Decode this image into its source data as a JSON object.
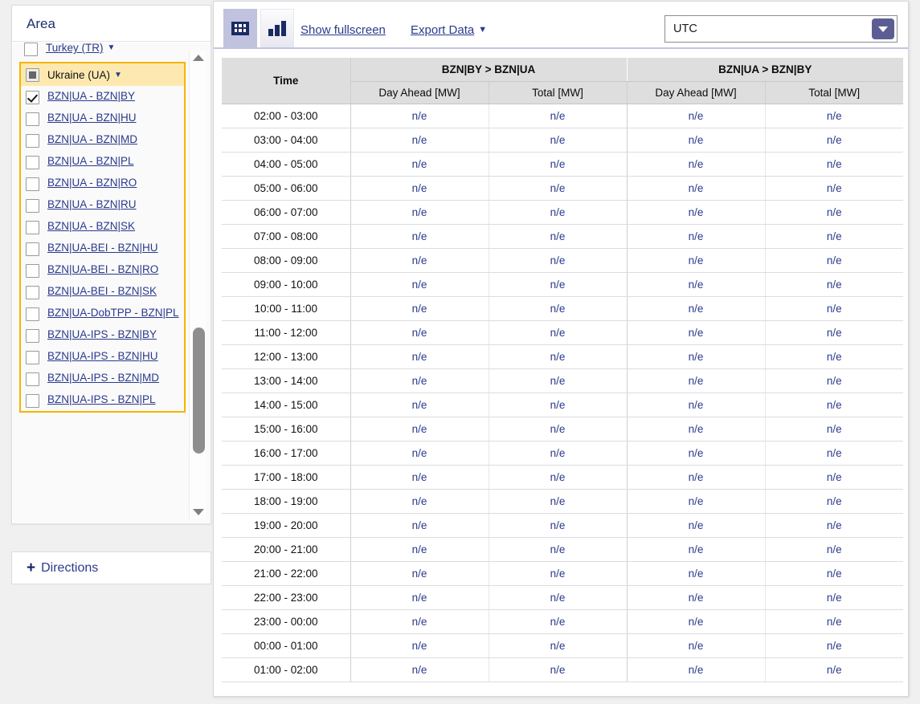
{
  "sidebar": {
    "area_panel": {
      "title": "Area",
      "ungrouped": [
        {
          "label": "Turkey (TR)",
          "checkbox": "unchecked",
          "caret": "▼",
          "is_link": true
        }
      ],
      "group": {
        "label": "Ukraine (UA)",
        "checkbox": "partial",
        "caret": "▼",
        "is_link": false,
        "items": [
          {
            "label": "BZN|UA - BZN|BY",
            "checkbox": "checked"
          },
          {
            "label": "BZN|UA - BZN|HU",
            "checkbox": "unchecked"
          },
          {
            "label": "BZN|UA - BZN|MD",
            "checkbox": "unchecked"
          },
          {
            "label": "BZN|UA - BZN|PL",
            "checkbox": "unchecked"
          },
          {
            "label": "BZN|UA - BZN|RO",
            "checkbox": "unchecked"
          },
          {
            "label": "BZN|UA - BZN|RU",
            "checkbox": "unchecked"
          },
          {
            "label": "BZN|UA - BZN|SK",
            "checkbox": "unchecked"
          },
          {
            "label": "BZN|UA-BEI - BZN|HU",
            "checkbox": "unchecked"
          },
          {
            "label": "BZN|UA-BEI - BZN|RO",
            "checkbox": "unchecked"
          },
          {
            "label": "BZN|UA-BEI - BZN|SK",
            "checkbox": "unchecked"
          },
          {
            "label": "BZN|UA-DobTPP - BZN|PL",
            "checkbox": "unchecked"
          },
          {
            "label": "BZN|UA-IPS - BZN|BY",
            "checkbox": "unchecked"
          },
          {
            "label": "BZN|UA-IPS - BZN|HU",
            "checkbox": "unchecked"
          },
          {
            "label": "BZN|UA-IPS - BZN|MD",
            "checkbox": "unchecked"
          },
          {
            "label": "BZN|UA-IPS - BZN|PL",
            "checkbox": "unchecked"
          }
        ]
      },
      "scrollbar": {
        "up_arrow": "scroll-up-icon",
        "down_arrow": "scroll-down-icon"
      }
    },
    "directions_panel": {
      "expand_icon": "plus-icon",
      "label": "Directions"
    }
  },
  "toolbar": {
    "tab_table_icon": "table-view-icon",
    "tab_chart_icon": "bar-chart-view-icon",
    "active_tab": "table",
    "fullscreen_label": "Show fullscreen",
    "export_label": "Export Data",
    "export_caret": "▼",
    "timezone": {
      "value": "UTC",
      "dropdown_icon": "chevron-down-icon"
    }
  },
  "colors": {
    "link": "#2b3a8c",
    "highlight": "#fde9b0",
    "highlight_border": "#f5b400",
    "header_bg": "#dedede",
    "active_tab_bg": "#c0c2de",
    "accent_dark": "#1b2a63"
  },
  "table": {
    "time_header": "Time",
    "groups": [
      {
        "label": "BZN|BY > BZN|UA",
        "columns": [
          "Day Ahead [MW]",
          "Total [MW]"
        ]
      },
      {
        "label": "BZN|UA > BZN|BY",
        "columns": [
          "Day Ahead [MW]",
          "Total [MW]"
        ]
      }
    ],
    "rows": [
      {
        "time": "02:00 - 03:00",
        "values": [
          "n/e",
          "n/e",
          "n/e",
          "n/e"
        ]
      },
      {
        "time": "03:00 - 04:00",
        "values": [
          "n/e",
          "n/e",
          "n/e",
          "n/e"
        ]
      },
      {
        "time": "04:00 - 05:00",
        "values": [
          "n/e",
          "n/e",
          "n/e",
          "n/e"
        ]
      },
      {
        "time": "05:00 - 06:00",
        "values": [
          "n/e",
          "n/e",
          "n/e",
          "n/e"
        ]
      },
      {
        "time": "06:00 - 07:00",
        "values": [
          "n/e",
          "n/e",
          "n/e",
          "n/e"
        ]
      },
      {
        "time": "07:00 - 08:00",
        "values": [
          "n/e",
          "n/e",
          "n/e",
          "n/e"
        ]
      },
      {
        "time": "08:00 - 09:00",
        "values": [
          "n/e",
          "n/e",
          "n/e",
          "n/e"
        ]
      },
      {
        "time": "09:00 - 10:00",
        "values": [
          "n/e",
          "n/e",
          "n/e",
          "n/e"
        ]
      },
      {
        "time": "10:00 - 11:00",
        "values": [
          "n/e",
          "n/e",
          "n/e",
          "n/e"
        ]
      },
      {
        "time": "11:00 - 12:00",
        "values": [
          "n/e",
          "n/e",
          "n/e",
          "n/e"
        ]
      },
      {
        "time": "12:00 - 13:00",
        "values": [
          "n/e",
          "n/e",
          "n/e",
          "n/e"
        ]
      },
      {
        "time": "13:00 - 14:00",
        "values": [
          "n/e",
          "n/e",
          "n/e",
          "n/e"
        ]
      },
      {
        "time": "14:00 - 15:00",
        "values": [
          "n/e",
          "n/e",
          "n/e",
          "n/e"
        ]
      },
      {
        "time": "15:00 - 16:00",
        "values": [
          "n/e",
          "n/e",
          "n/e",
          "n/e"
        ]
      },
      {
        "time": "16:00 - 17:00",
        "values": [
          "n/e",
          "n/e",
          "n/e",
          "n/e"
        ]
      },
      {
        "time": "17:00 - 18:00",
        "values": [
          "n/e",
          "n/e",
          "n/e",
          "n/e"
        ]
      },
      {
        "time": "18:00 - 19:00",
        "values": [
          "n/e",
          "n/e",
          "n/e",
          "n/e"
        ]
      },
      {
        "time": "19:00 - 20:00",
        "values": [
          "n/e",
          "n/e",
          "n/e",
          "n/e"
        ]
      },
      {
        "time": "20:00 - 21:00",
        "values": [
          "n/e",
          "n/e",
          "n/e",
          "n/e"
        ]
      },
      {
        "time": "21:00 - 22:00",
        "values": [
          "n/e",
          "n/e",
          "n/e",
          "n/e"
        ]
      },
      {
        "time": "22:00 - 23:00",
        "values": [
          "n/e",
          "n/e",
          "n/e",
          "n/e"
        ]
      },
      {
        "time": "23:00 - 00:00",
        "values": [
          "n/e",
          "n/e",
          "n/e",
          "n/e"
        ]
      },
      {
        "time": "00:00 - 01:00",
        "values": [
          "n/e",
          "n/e",
          "n/e",
          "n/e"
        ]
      },
      {
        "time": "01:00 - 02:00",
        "values": [
          "n/e",
          "n/e",
          "n/e",
          "n/e"
        ]
      }
    ]
  }
}
